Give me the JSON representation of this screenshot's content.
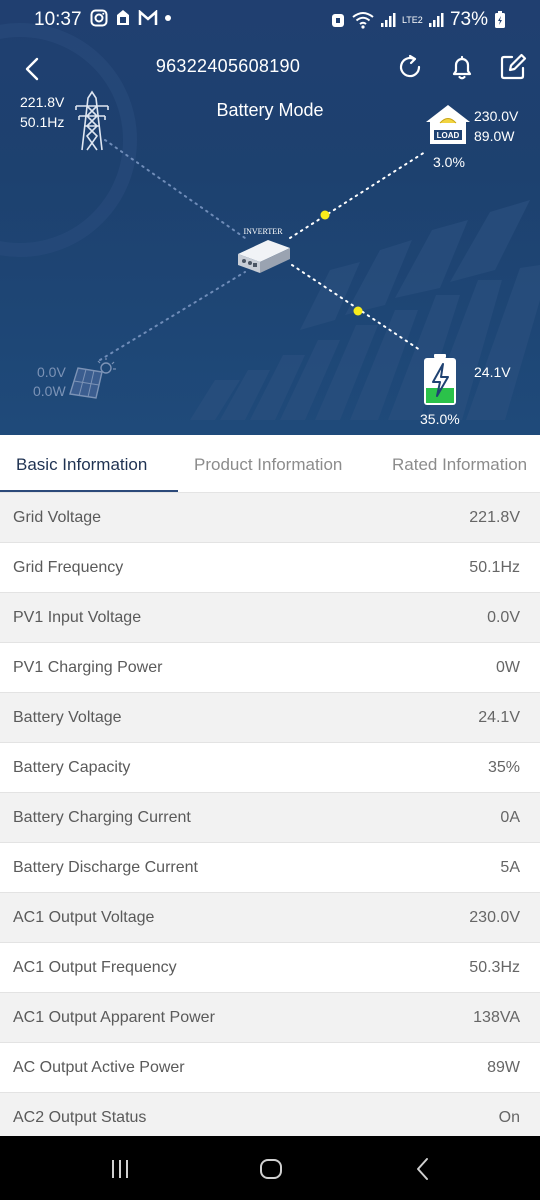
{
  "status_bar": {
    "time": "10:37",
    "battery_percent": "73%",
    "network_label": "LTE2",
    "left_icons": [
      "instagram-icon",
      "pay-icon",
      "gmail-icon",
      "dot-icon"
    ],
    "right_icons": [
      "alarm-icon",
      "wifi-icon",
      "signal-icon",
      "volte-icon",
      "signal-icon",
      "battery-charging-icon"
    ]
  },
  "header": {
    "device_id": "96322405608190",
    "mode": "Battery Mode",
    "icons": [
      "back-icon",
      "refresh-icon",
      "bell-icon",
      "edit-icon"
    ]
  },
  "diagram": {
    "grid": {
      "voltage": "221.8V",
      "frequency": "50.1Hz"
    },
    "load": {
      "voltage": "230.0V",
      "power": "89.0W",
      "percent": "3.0%",
      "icon_text": "LOAD"
    },
    "inverter": {
      "label": "INVERTER"
    },
    "pv": {
      "voltage": "0.0V",
      "power": "0.0W"
    },
    "battery": {
      "voltage": "24.1V",
      "percent": "35.0%",
      "level": 0.35
    },
    "colors": {
      "flow_dot": "#f7ec1c",
      "battery_fill": "#2bc24a",
      "background": "#1f4272"
    }
  },
  "tabs": [
    {
      "label": "Basic Information",
      "active": true
    },
    {
      "label": "Product Information",
      "active": false
    },
    {
      "label": "Rated Information",
      "active": false
    }
  ],
  "rows": [
    {
      "label": "Grid Voltage",
      "value": "221.8V"
    },
    {
      "label": "Grid Frequency",
      "value": "50.1Hz"
    },
    {
      "label": "PV1 Input Voltage",
      "value": "0.0V"
    },
    {
      "label": "PV1 Charging Power",
      "value": "0W"
    },
    {
      "label": "Battery Voltage",
      "value": "24.1V"
    },
    {
      "label": "Battery Capacity",
      "value": "35%"
    },
    {
      "label": "Battery Charging Current",
      "value": "0A"
    },
    {
      "label": "Battery Discharge Current",
      "value": "5A"
    },
    {
      "label": "AC1 Output Voltage",
      "value": "230.0V"
    },
    {
      "label": "AC1 Output Frequency",
      "value": "50.3Hz"
    },
    {
      "label": "AC1 Output Apparent Power",
      "value": "138VA"
    },
    {
      "label": "AC Output Active Power",
      "value": "89W"
    },
    {
      "label": "AC2 Output Status",
      "value": "On"
    }
  ],
  "nav_bar": {
    "icons": [
      "recent-apps-icon",
      "home-icon",
      "back-nav-icon"
    ]
  }
}
